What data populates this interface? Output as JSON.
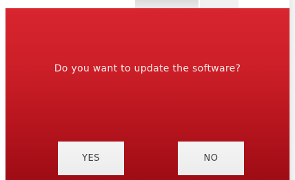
{
  "dialog": {
    "message": "Do you want to update the software?",
    "background_color": "#c81d26",
    "yes_label": "YES",
    "no_label": "NO",
    "button_color": "#f0f0f0"
  }
}
